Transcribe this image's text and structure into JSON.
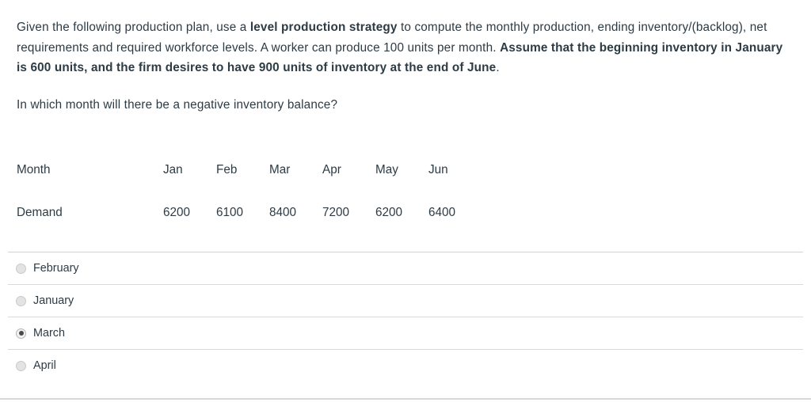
{
  "question": {
    "paragraph1": {
      "segments": [
        {
          "text": "Given the following production plan, use a ",
          "bold": false
        },
        {
          "text": "level production strategy",
          "bold": true
        },
        {
          "text": " to compute the monthly production, ending inventory/(backlog), net requirements and required workforce levels. A worker can produce 100 units per month. ",
          "bold": false
        },
        {
          "text": "Assume that the beginning inventory in January is 600 units, and the firm desires to have 900 units of inventory at the end of June",
          "bold": true
        },
        {
          "text": ".",
          "bold": false
        }
      ]
    },
    "paragraph2": {
      "segments": [
        {
          "text": "In which month will there be a negative inventory balance?",
          "bold": false
        }
      ]
    }
  },
  "table": {
    "rows": [
      {
        "label": "Month",
        "cells": [
          "Jan",
          "Feb",
          "Mar",
          "Apr",
          "May",
          "Jun"
        ]
      },
      {
        "label": "Demand",
        "cells": [
          "6200",
          "6100",
          "8400",
          "7200",
          "6200",
          "6400"
        ]
      }
    ]
  },
  "answers": {
    "options": [
      {
        "label": "February",
        "selected": false
      },
      {
        "label": "January",
        "selected": false
      },
      {
        "label": "March",
        "selected": true
      },
      {
        "label": "April",
        "selected": false
      }
    ]
  },
  "colors": {
    "text": "#2d3b45",
    "divider": "#d9d9d9",
    "radio_fill": "#e3e3e3",
    "radio_dot": "#4a4a4a",
    "background": "#ffffff"
  }
}
